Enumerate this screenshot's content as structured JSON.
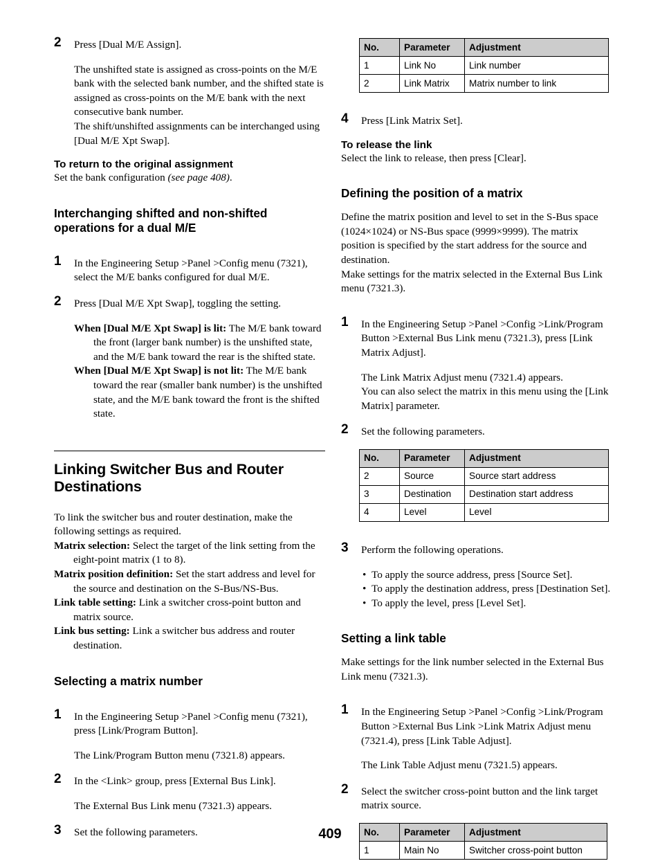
{
  "page": {
    "number": "409",
    "colors": {
      "table_header_bg": "#cccccc",
      "text": "#000000",
      "rule": "#000000"
    }
  },
  "left_column": {
    "step2": {
      "num": "2",
      "instruction": "Press [Dual M/E Assign].",
      "explanation": "The unshifted state is assigned as cross-points on the M/E bank with the selected bank number, and the shifted state is assigned as cross-points on the M/E bank with the next consecutive bank number.\nThe shift/unshifted assignments can be interchanged using [Dual M/E Xpt Swap]."
    },
    "return_heading": "To return to the original assignment",
    "return_text_plain": "Set the bank configuration ",
    "return_text_italic": "(see page 408)",
    "return_text_tail": ".",
    "interchange_heading": "Interchanging shifted and non-shifted operations for a dual M/E",
    "interchange_step1": {
      "num": "1",
      "text": "In the Engineering Setup >Panel >Config menu (7321), select the M/E banks configured for dual M/E."
    },
    "interchange_step2": {
      "num": "2",
      "text": "Press [Dual M/E Xpt Swap], toggling the setting.",
      "cases": [
        {
          "label": "When [Dual M/E Xpt Swap] is lit:",
          "body": " The M/E bank toward the front (larger bank number) is the unshifted state, and the M/E bank toward the rear is the shifted state."
        },
        {
          "label": "When [Dual M/E Xpt Swap] is not lit:",
          "body": " The M/E bank toward the rear (smaller bank number) is the unshifted state, and the M/E bank toward the front is the shifted state."
        }
      ]
    },
    "main_heading": "Linking Switcher Bus and Router Destinations",
    "main_intro": "To link the switcher bus and router destination, make the following settings as required.",
    "definitions": [
      {
        "term": "Matrix selection:",
        "desc": " Select the target of the link setting from the eight-point matrix (1 to 8)."
      },
      {
        "term": "Matrix position definition:",
        "desc": " Set the start address and level for the source and destination on the S-Bus/NS-Bus."
      },
      {
        "term": "Link table setting:",
        "desc": " Link a switcher cross-point button and matrix source."
      },
      {
        "term": "Link bus setting:",
        "desc": " Link a switcher bus address and router destination."
      }
    ],
    "selecting_heading": "Selecting a matrix number",
    "selecting_steps": [
      {
        "num": "1",
        "text": "In the Engineering Setup >Panel >Config menu (7321), press [Link/Program Button].",
        "result": "The Link/Program Button menu (7321.8) appears."
      },
      {
        "num": "2",
        "text": "In the <Link> group, press [External Bus Link].",
        "result": "The External Bus Link menu (7321.3) appears."
      },
      {
        "num": "3",
        "text": "Set the following parameters.",
        "result": ""
      }
    ]
  },
  "right_column": {
    "table_link": {
      "headers": [
        "No.",
        "Parameter",
        "Adjustment"
      ],
      "rows": [
        [
          "1",
          "Link No",
          "Link number"
        ],
        [
          "2",
          "Link Matrix",
          "Matrix number to link"
        ]
      ]
    },
    "step4": {
      "num": "4",
      "text": "Press [Link Matrix Set]."
    },
    "release_heading": "To release the link",
    "release_text": "Select the link to release, then press [Clear].",
    "defining_heading": "Defining the position of a matrix",
    "defining_text": "Define the matrix position and level to set in the S-Bus space (1024×1024) or NS-Bus space (9999×9999). The matrix position is specified by the start address for the source and destination.\nMake settings for the matrix selected in the External Bus Link menu (7321.3).",
    "defining_steps": [
      {
        "num": "1",
        "text": "In the Engineering Setup >Panel >Config >Link/Program Button >External Bus Link menu (7321.3), press [Link Matrix Adjust].",
        "result": "The Link Matrix Adjust menu (7321.4) appears.\nYou can also select the matrix in this menu using the [Link Matrix] parameter."
      },
      {
        "num": "2",
        "text": "Set the following parameters."
      }
    ],
    "table_matrix": {
      "headers": [
        "No.",
        "Parameter",
        "Adjustment"
      ],
      "rows": [
        [
          "2",
          "Source",
          "Source start address"
        ],
        [
          "3",
          "Destination",
          "Destination start address"
        ],
        [
          "4",
          "Level",
          "Level"
        ]
      ]
    },
    "step3": {
      "num": "3",
      "text": "Perform the following operations.",
      "bullets": [
        "To apply the source address, press [Source Set].",
        "To apply the destination address, press [Destination Set].",
        "To apply the level, press [Level Set]."
      ]
    },
    "link_table_heading": "Setting a link table",
    "link_table_intro": "Make settings for the link number selected in the External Bus Link menu (7321.3).",
    "link_table_steps": [
      {
        "num": "1",
        "text": "In the Engineering Setup >Panel >Config >Link/Program Button >External Bus Link >Link Matrix Adjust menu (7321.4), press [Link Table Adjust].",
        "result": "The Link Table Adjust menu (7321.5) appears."
      },
      {
        "num": "2",
        "text": "Select the switcher cross-point button and the link target matrix source."
      }
    ],
    "table_main": {
      "headers": [
        "No.",
        "Parameter",
        "Adjustment"
      ],
      "rows": [
        [
          "1",
          "Main No",
          "Switcher cross-point button"
        ]
      ]
    }
  }
}
